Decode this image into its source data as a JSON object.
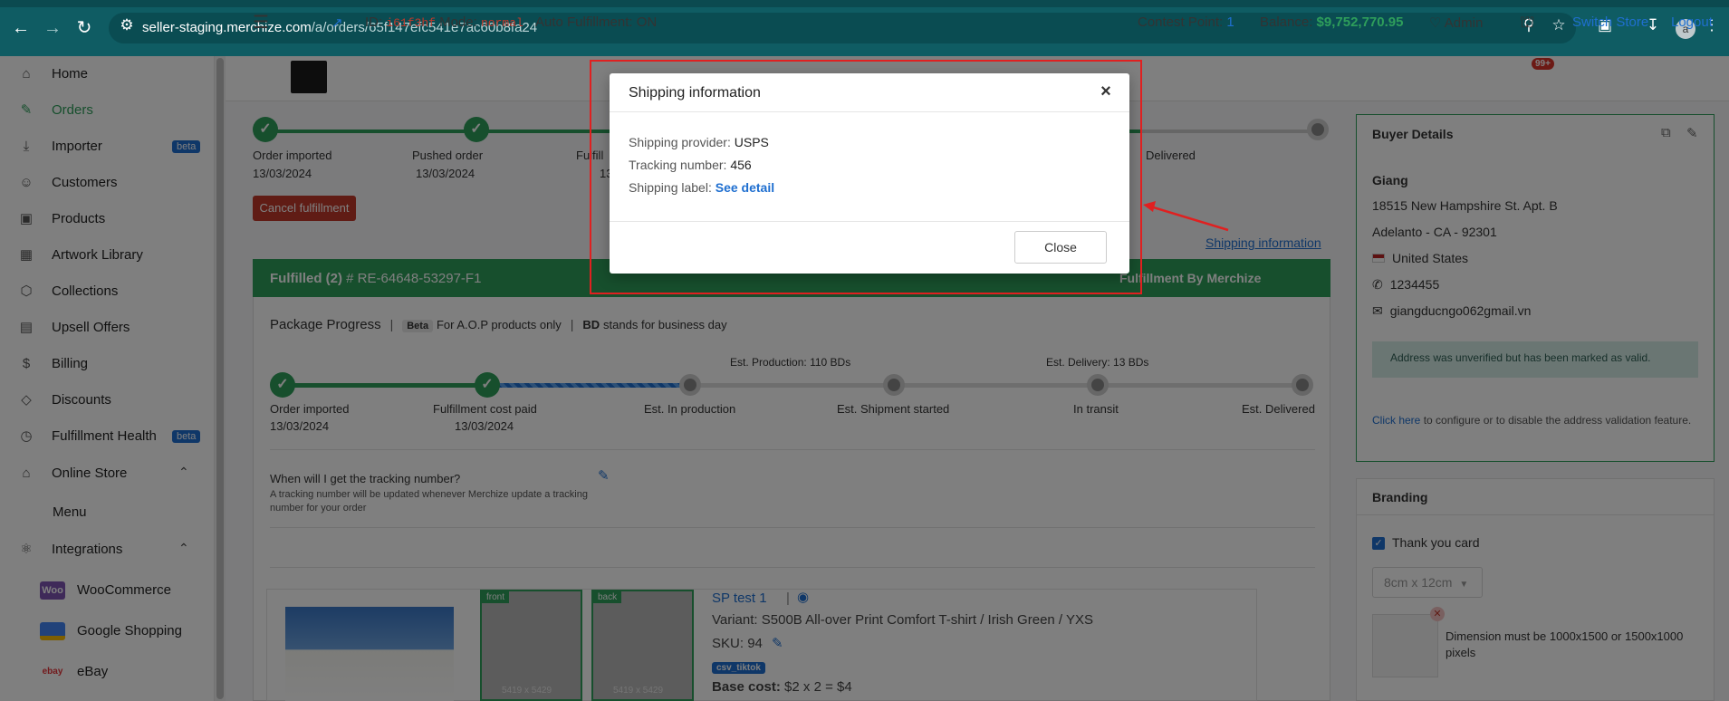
{
  "browser": {
    "url_host": "seller-staging.merchize.com",
    "url_path": "/a/orders/65f147efc541e7ac60b8fa24",
    "profile_initial": "a"
  },
  "sidebar": {
    "items": [
      {
        "label": "Home",
        "icon": "home-icon"
      },
      {
        "label": "Orders",
        "icon": "orders-icon",
        "active": true
      },
      {
        "label": "Importer",
        "icon": "import-icon",
        "badge": "beta"
      },
      {
        "label": "Customers",
        "icon": "user-icon"
      },
      {
        "label": "Products",
        "icon": "box-icon"
      },
      {
        "label": "Artwork Library",
        "icon": "image-icon"
      },
      {
        "label": "Collections",
        "icon": "cube-icon"
      },
      {
        "label": "Upsell Offers",
        "icon": "clipboard-icon"
      },
      {
        "label": "Billing",
        "icon": "dollar-icon"
      },
      {
        "label": "Discounts",
        "icon": "tag-icon"
      },
      {
        "label": "Fulfillment Health",
        "icon": "clock-icon",
        "badge": "beta"
      },
      {
        "label": "Online Store",
        "icon": "store-icon"
      },
      {
        "label": "Menu"
      },
      {
        "label": "Integrations",
        "icon": "plug-icon"
      }
    ],
    "integrations": [
      {
        "label": "WooCommerce",
        "logo": "Woo"
      },
      {
        "label": "Google Shopping",
        "logo": "google-shopping-logo"
      },
      {
        "label": "eBay",
        "logo": "ebay"
      }
    ]
  },
  "topbar": {
    "id_label": "ID:",
    "id_value": "i61f3hf",
    "mode_label": "Mode:",
    "mode_value": "normal",
    "auto_fulfill": "Auto Fulfillment: ON",
    "contest_label": "Contest Point:",
    "contest_value": "1",
    "balance_label": "Balance:",
    "balance_value": "$9,752,770.95",
    "admin": "Admin",
    "notif_count": "99+",
    "switch_store": "Switch Store",
    "logout": "Logout"
  },
  "order_steps": [
    {
      "label": "Order imported",
      "date": "13/03/2024"
    },
    {
      "label": "Pushed order",
      "date": "13/03/2024"
    },
    {
      "label": "Fulfill",
      "date": "13"
    },
    {
      "label": "Delivered",
      "date": ""
    }
  ],
  "cancel_button": "Cancel fulfillment",
  "shipping_info_link": "Shipping information",
  "fulfillment": {
    "title": "Fulfilled (2)",
    "code": "# RE-64648-53297-F1",
    "by": "Fulfillment By Merchize",
    "package_progress": "Package Progress",
    "beta": "Beta",
    "aop_note": "For A.O.P products only",
    "bd_bold": "BD",
    "bd_note": "stands for business day",
    "est_production_label": "Est. Production:",
    "est_production_value": "110 BDs",
    "est_delivery_label": "Est. Delivery:",
    "est_delivery_value": "13 BDs",
    "steps": [
      {
        "label": "Order imported",
        "date": "13/03/2024"
      },
      {
        "label": "Fulfillment cost paid",
        "date": "13/03/2024"
      },
      {
        "label": "Est. In production",
        "date": ""
      },
      {
        "label": "Est. Shipment started",
        "date": ""
      },
      {
        "label": "In transit",
        "date": ""
      },
      {
        "label": "Est. Delivered",
        "date": ""
      }
    ],
    "tracking_question": "When will I get the tracking number?",
    "tracking_answer": "A tracking number will be updated whenever Merchize update a tracking number for your order"
  },
  "product": {
    "title": "SP test 1",
    "variant": "Variant: S500B All-over Print Comfort T-shirt / Irish Green / YXS",
    "sku_label": "SKU:",
    "sku_value": "94",
    "tag": "csv_tiktok",
    "base_cost_label": "Base cost:",
    "base_cost_value": "$2 x 2 = $4",
    "thumb_front": "front",
    "thumb_back": "back",
    "thumb_size": "5419 x 5429"
  },
  "buyer": {
    "title": "Buyer Details",
    "name": "Giang",
    "address1": "18515 New Hampshire St. Apt. B",
    "address2": "Adelanto - CA - 92301",
    "country": "United States",
    "phone": "1234455",
    "email": "giangducngo062gmail.vn",
    "note": "Address was unverified but has been marked as valid.",
    "cfg_link": "Click here",
    "cfg_text": "to configure or to disable the address validation feature."
  },
  "branding": {
    "title": "Branding",
    "thank_you": "Thank you card",
    "size": "8cm x 12cm",
    "dimension_note": "Dimension must be 1000x1500 or 1500x1000 pixels"
  },
  "modal": {
    "title": "Shipping information",
    "provider_label": "Shipping provider:",
    "provider_value": "USPS",
    "tracking_label": "Tracking number:",
    "tracking_value": "456",
    "label_label": "Shipping label:",
    "label_link": "See detail",
    "close_button": "Close"
  },
  "colors": {
    "brand_green": "#2e9e5b",
    "link_blue": "#1f6fd0",
    "annotation_red": "#e02020"
  }
}
